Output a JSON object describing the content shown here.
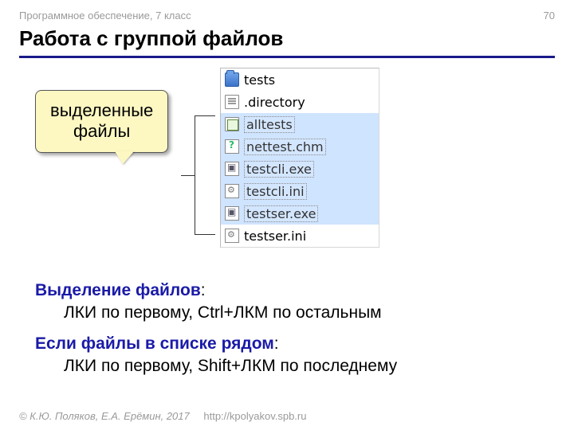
{
  "header": {
    "course": "Программное обеспечение, 7 класс",
    "page": "70"
  },
  "title": "Работа с группой файлов",
  "callout": {
    "line1": "выделенные",
    "line2": "файлы"
  },
  "files": [
    {
      "name": "tests",
      "icon": "folder",
      "selected": false
    },
    {
      "name": ".directory",
      "icon": "doc",
      "selected": false
    },
    {
      "name": "alltests",
      "icon": "page",
      "selected": true
    },
    {
      "name": "nettest.chm",
      "icon": "chm",
      "selected": true
    },
    {
      "name": "testcli.exe",
      "icon": "exe",
      "selected": true
    },
    {
      "name": "testcli.ini",
      "icon": "ini",
      "selected": true
    },
    {
      "name": "testser.exe",
      "icon": "exe",
      "selected": true
    },
    {
      "name": "testser.ini",
      "icon": "ini",
      "selected": false
    }
  ],
  "instructions": {
    "sel_lead": "Выделение файлов",
    "sel_desc": "ЛКИ по первому, Ctrl+ЛКМ по остальным",
    "adj_lead": "Если файлы в списке рядом",
    "adj_desc": "ЛКИ по первому, Shift+ЛКМ по последнему",
    "colon": ":"
  },
  "footer": {
    "copyright": "© К.Ю. Поляков, Е.А. Ерёмин, 2017",
    "url": "http://kpolyakov.spb.ru"
  }
}
